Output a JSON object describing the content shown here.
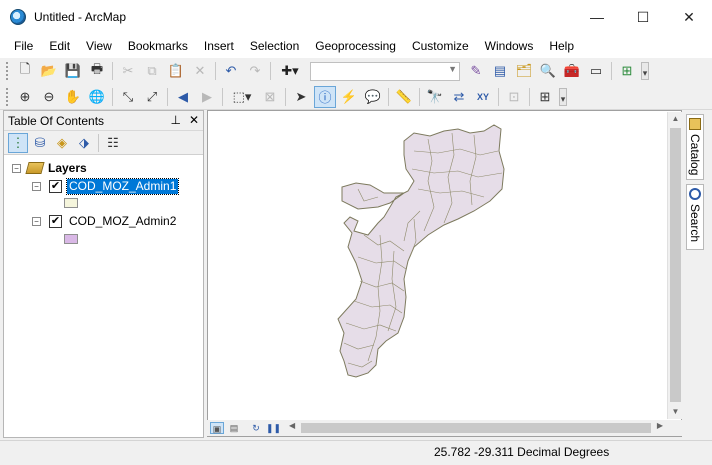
{
  "window": {
    "title": "Untitled - ArcMap",
    "minimize_glyph": "—",
    "maximize_glyph": "☐",
    "close_glyph": "✕"
  },
  "menu": [
    "File",
    "Edit",
    "View",
    "Bookmarks",
    "Insert",
    "Selection",
    "Geoprocessing",
    "Customize",
    "Windows",
    "Help"
  ],
  "toc": {
    "title": "Table Of Contents",
    "pin_glyph": "📌",
    "close_glyph": "✕",
    "root_label": "Layers",
    "layers": [
      {
        "name": "COD_MOZ_Admin1",
        "checked": true,
        "selected": true,
        "swatch_color": "#f5f5dc"
      },
      {
        "name": "COD_MOZ_Admin2",
        "checked": true,
        "selected": false,
        "swatch_color": "#d9b8e6"
      }
    ],
    "expander_glyph": "−",
    "check_glyph": "✔"
  },
  "dock": {
    "tabs": [
      "Catalog",
      "Search"
    ]
  },
  "status": {
    "coordinates": "25.782  -29.311 Decimal Degrees"
  },
  "colors": {
    "map_fill": "#e6dde8",
    "map_stroke": "#7d7a5e",
    "selection": "#0078d7"
  }
}
